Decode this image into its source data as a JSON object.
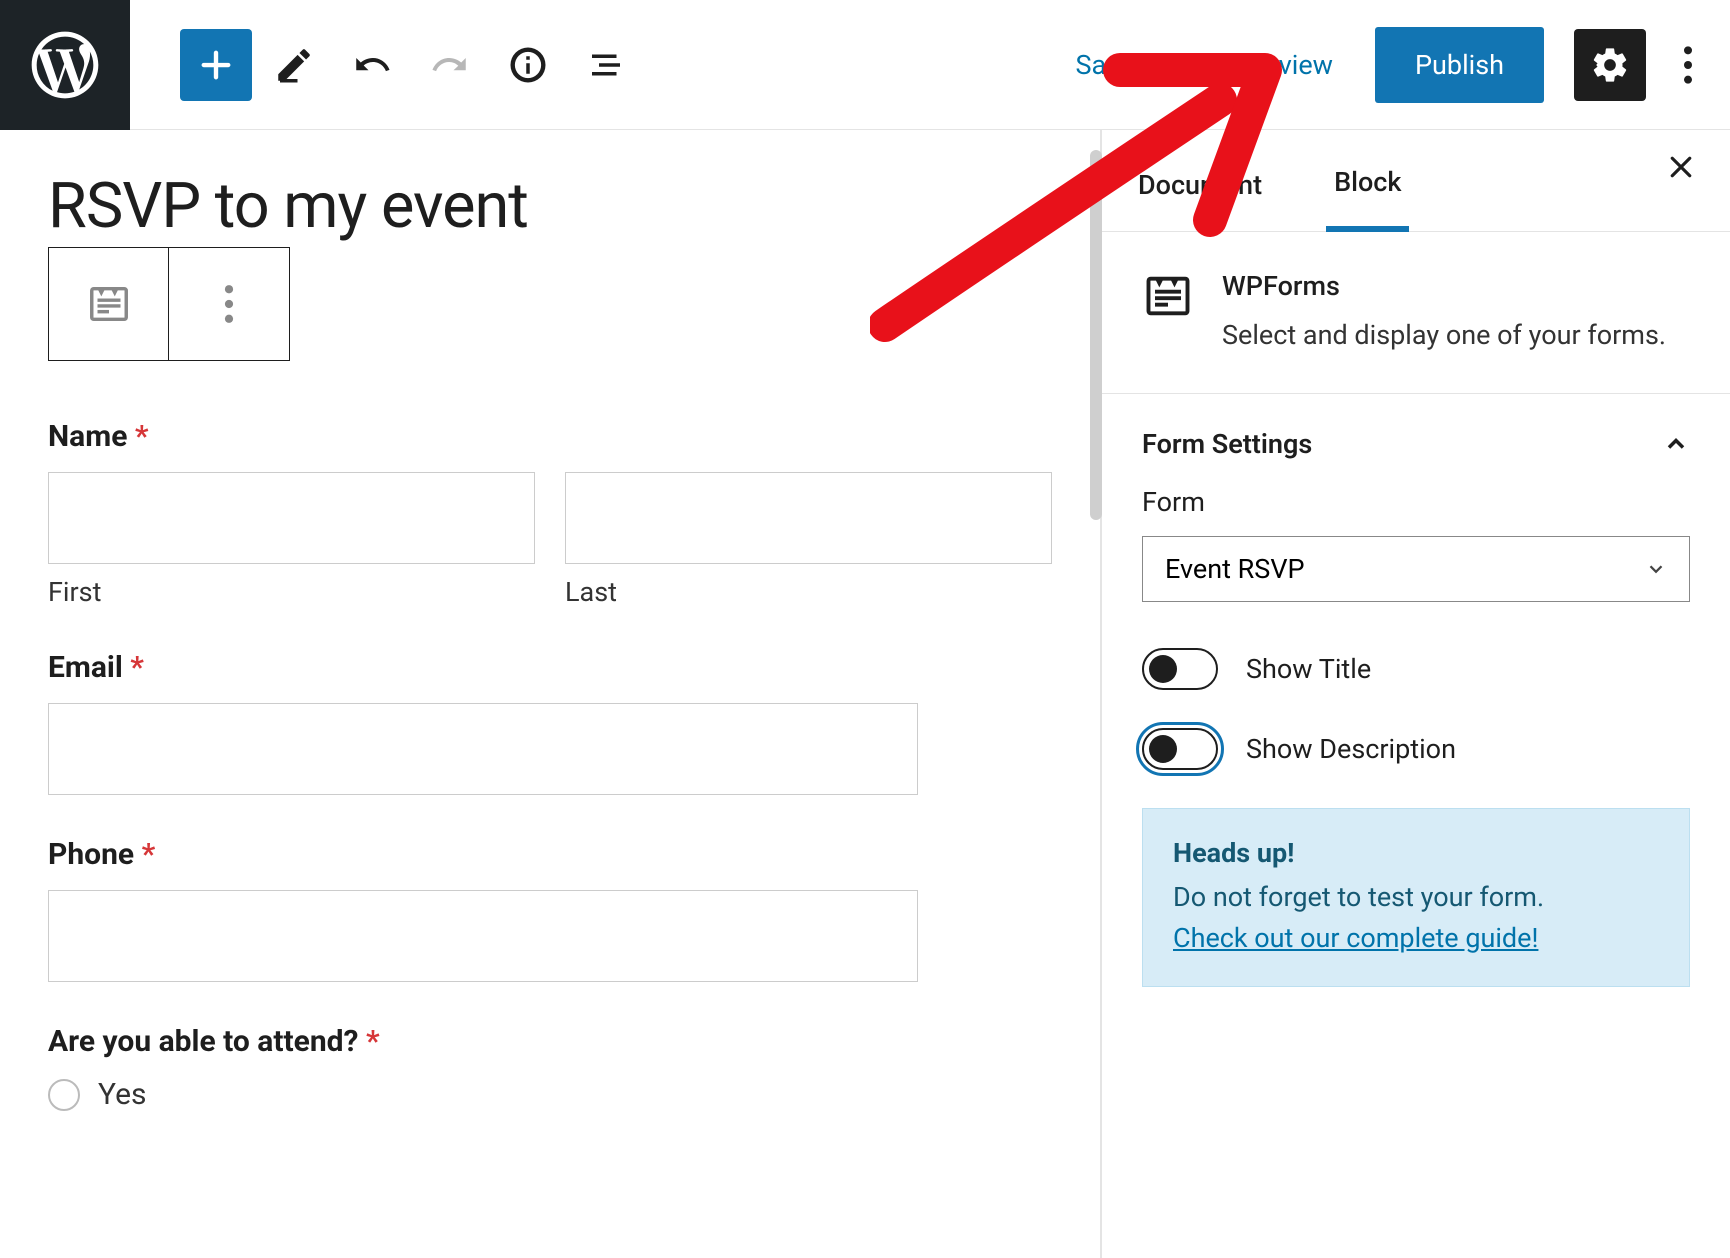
{
  "topbar": {
    "save_draft": "Save draft",
    "preview": "Preview",
    "publish": "Publish"
  },
  "editor": {
    "title": "RSVP to my event",
    "fields": {
      "name_label": "Name",
      "first": "First",
      "last": "Last",
      "email_label": "Email",
      "phone_label": "Phone",
      "attend_label": "Are you able to attend?",
      "yes": "Yes"
    }
  },
  "sidebar": {
    "tabs": {
      "document": "Document",
      "block": "Block"
    },
    "block_info": {
      "title": "WPForms",
      "desc": "Select and display one of your forms."
    },
    "section": "Form Settings",
    "form_label": "Form",
    "form_value": "Event RSVP",
    "toggles": {
      "show_title": "Show Title",
      "show_desc": "Show Description"
    },
    "heads_up": {
      "title": "Heads up!",
      "text": "Do not forget to test your form.",
      "link": "Check out our complete guide!"
    }
  },
  "required_marker": "*"
}
